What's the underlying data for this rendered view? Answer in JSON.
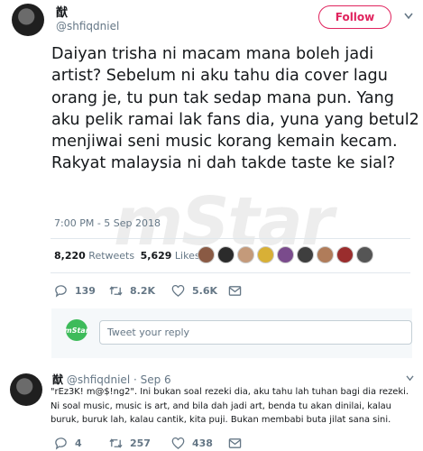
{
  "tweet": {
    "display_name": "猷",
    "handle": "@shfiqdniel",
    "follow_label": "Follow",
    "text": "Daiyan trisha ni macam mana boleh jadi artist? Sebelum ni aku tahu dia cover lagu orang je, tu pun tak sedap mana pun. Yang aku pelik ramai lak fans dia, yuna yang betul2 menjiwai seni music korang kemain kecam. Rakyat malaysia ni dah takde taste ke sial?",
    "timestamp": "7:00 PM - 5 Sep 2018",
    "retweets_count": "8,220",
    "retweets_label": "Retweets",
    "likes_count": "5,629",
    "likes_label": "Likes",
    "actions": {
      "replies": "139",
      "retweets": "8.2K",
      "likes": "5.6K"
    }
  },
  "reply_box": {
    "logo_text": "mStar",
    "placeholder": "Tweet your reply"
  },
  "reply": {
    "display_name": "猷",
    "handle_and_date": "@shfiqdniel · Sep 6",
    "text": "\"rEz3K! m@$!ng2\". Ini bukan soal rezeki dia, aku tahu lah tuhan bagi dia rezeki. Ni soal music, music is art, and bila dah jadi art, benda tu akan dinilai, kalau buruk, buruk lah, kalau cantik, kita puji. Bukan membabi buta jilat sana sini.",
    "actions": {
      "replies": "4",
      "retweets": "257",
      "likes": "438"
    }
  },
  "watermark": "mStar",
  "colors": {
    "accent": "#e0245e",
    "muted": "#657786",
    "brand_green": "#3dbb5a"
  }
}
